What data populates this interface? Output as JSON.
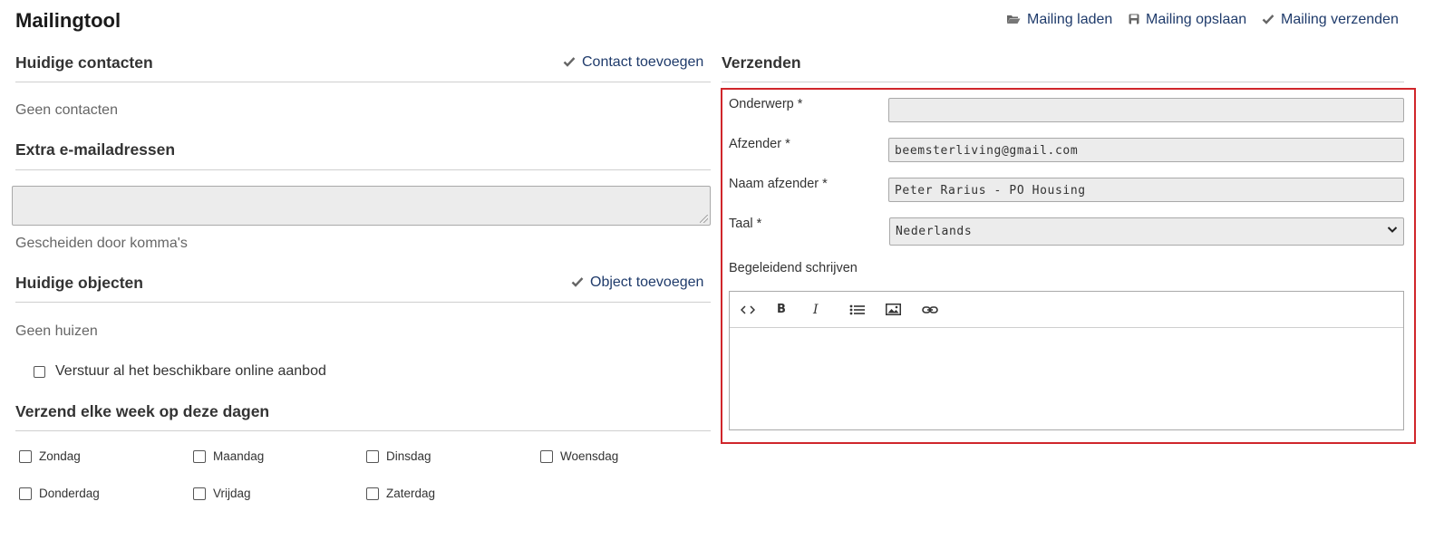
{
  "app": {
    "title": "Mailingtool"
  },
  "toolbar": {
    "load_label": "Mailing laden",
    "save_label": "Mailing opslaan",
    "send_label": "Mailing verzenden",
    "load_icon": "folder-open-icon",
    "save_icon": "floppy-disk-icon",
    "send_icon": "checkmark-icon"
  },
  "contacts": {
    "title": "Huidige contacten",
    "add_label": "Contact toevoegen",
    "empty_text": "Geen contacten"
  },
  "extra_emails": {
    "title": "Extra e-mailadressen",
    "value": "",
    "hint": "Gescheiden door komma's"
  },
  "objects": {
    "title": "Huidige objecten",
    "add_label": "Object toevoegen",
    "empty_text": "Geen huizen",
    "all_online_label": "Verstuur al het beschikbare online aanbod"
  },
  "weekly": {
    "title": "Verzend elke week op deze dagen",
    "days": [
      "Zondag",
      "Maandag",
      "Dinsdag",
      "Woensdag",
      "Donderdag",
      "Vrijdag",
      "Zaterdag"
    ]
  },
  "send": {
    "title": "Verzenden",
    "subject_label": "Onderwerp *",
    "subject_value": "",
    "sender_label": "Afzender *",
    "sender_value": "beemsterliving@gmail.com",
    "sender_name_label": "Naam afzender *",
    "sender_name_value": "Peter Rarius - PO Housing",
    "language_label": "Taal *",
    "language_value": "Nederlands",
    "letter_label": "Begeleidend schrijven",
    "editor_tools": [
      "code-icon",
      "bold-icon",
      "italic-icon",
      "bulleted-list-icon",
      "image-icon",
      "link-icon"
    ]
  },
  "colors": {
    "link": "#1f3b6b",
    "highlight_border": "#d0262b",
    "input_bg": "#ececec"
  }
}
